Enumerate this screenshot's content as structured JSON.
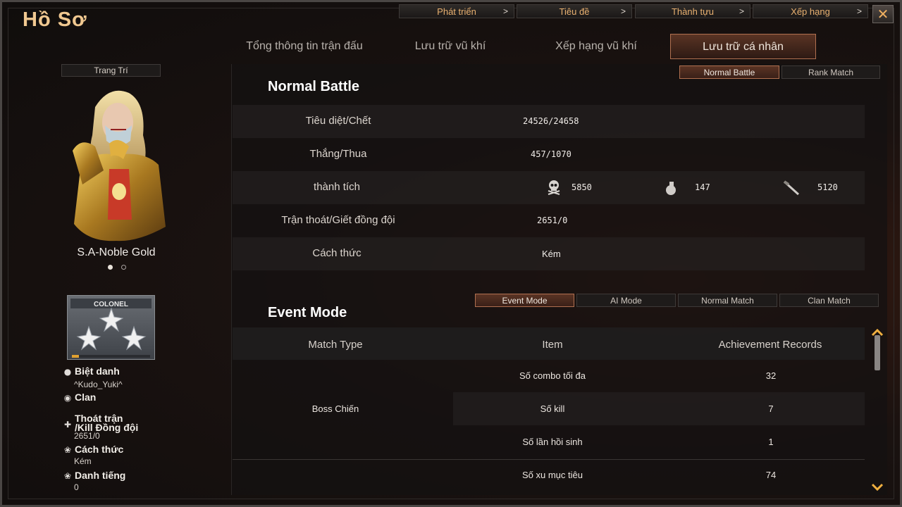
{
  "window": {
    "title": "Hồ Sơ",
    "close_glyph": "✕"
  },
  "top_nav": [
    {
      "label": "Phát triển",
      "arrow": ">"
    },
    {
      "label": "Tiêu đề",
      "arrow": ">"
    },
    {
      "label": "Thành tựu",
      "arrow": ">"
    },
    {
      "label": "Xếp hạng",
      "arrow": ">"
    }
  ],
  "main_tabs": [
    {
      "label": "Tổng thông tin trận đấu",
      "active": false
    },
    {
      "label": "Lưu trữ vũ khí",
      "active": false
    },
    {
      "label": "Xếp hạng vũ khí",
      "active": false
    },
    {
      "label": "Lưu trữ cá nhân",
      "active": true
    }
  ],
  "sidebar": {
    "decor_button": "Trang Trí",
    "character_name": "S.A-Noble Gold",
    "carousel": {
      "count": 2,
      "active_index": 0
    },
    "rank_badge": "COLONEL",
    "fields": [
      {
        "label": "Biệt danh",
        "value": "^Kudo_Yuki^",
        "icon": "person-icon"
      },
      {
        "label": "Clan",
        "value": "",
        "icon": "clan-icon"
      },
      {
        "label": "Thoát trận\n/Kill Đồng đội",
        "value": "2651/0",
        "icon": "runner-icon"
      },
      {
        "label": "Cách thức",
        "value": "Kém",
        "icon": "clover-icon"
      },
      {
        "label": "Danh tiếng",
        "value": "0",
        "icon": "clover-icon"
      }
    ]
  },
  "normal_battle": {
    "title": "Normal Battle",
    "mode_tabs": [
      {
        "label": "Normal Battle",
        "active": true
      },
      {
        "label": "Rank Match",
        "active": false
      }
    ],
    "rows": [
      {
        "label": "Tiêu diệt/Chết",
        "value": "24526/24658"
      },
      {
        "label": "Thắng/Thua",
        "value": "457/1070"
      },
      {
        "label": "thành tích",
        "value": ""
      },
      {
        "label": "Trận thoát/Giết đồng đội",
        "value": "2651/0"
      },
      {
        "label": "Cách thức",
        "value": "Kém"
      }
    ],
    "achievements": [
      {
        "icon": "skull-icon",
        "value": "5850"
      },
      {
        "icon": "grenade-icon",
        "value": "147"
      },
      {
        "icon": "knife-icon",
        "value": "5120"
      }
    ]
  },
  "event_mode": {
    "title": "Event Mode",
    "mode_tabs": [
      {
        "label": "Event Mode",
        "active": true
      },
      {
        "label": "AI Mode",
        "active": false
      },
      {
        "label": "Normal Match",
        "active": false
      },
      {
        "label": "Clan Match",
        "active": false
      }
    ],
    "columns": [
      "Match Type",
      "Item",
      "Achievement Records"
    ],
    "group_name": "Boss Chiến",
    "rows": [
      {
        "item": "Số combo tối đa",
        "record": "32"
      },
      {
        "item": "Số kill",
        "record": "7"
      },
      {
        "item": "Số lần hồi sinh",
        "record": "1"
      },
      {
        "item": "Số xu mục tiêu",
        "record": "74"
      }
    ]
  },
  "colors": {
    "accent": "#f0c890",
    "tab_active_border": "#b07050",
    "panel_bg": "#141212"
  }
}
